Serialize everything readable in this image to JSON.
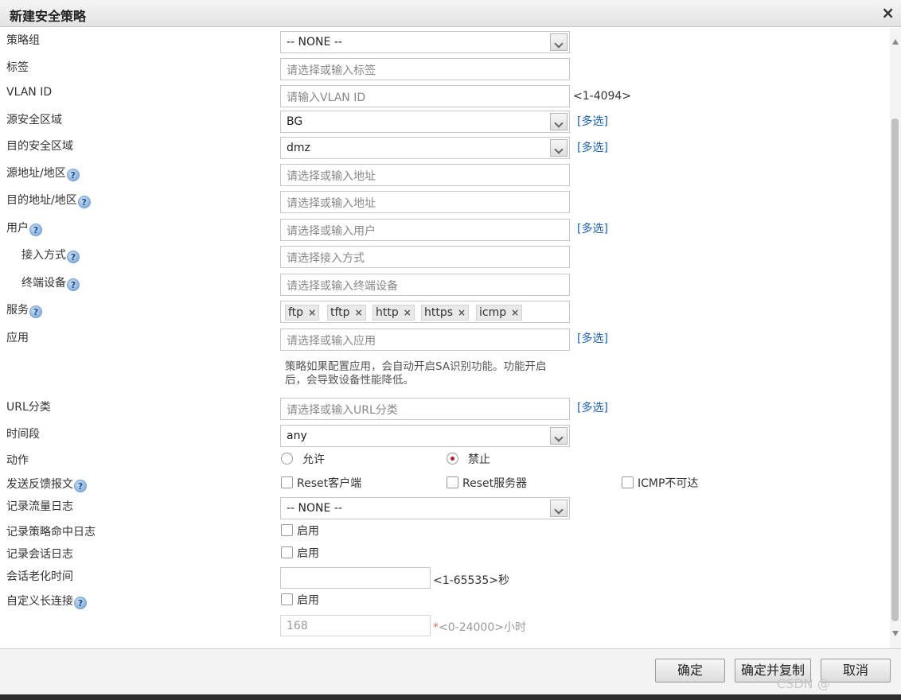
{
  "dialog": {
    "title": "新建安全策略",
    "close": "×"
  },
  "form": {
    "policy_group": {
      "label": "策略组",
      "value": "-- NONE --"
    },
    "tag": {
      "label": "标签",
      "placeholder": "请选择或输入标签"
    },
    "vlan": {
      "label": "VLAN ID",
      "placeholder": "请输入VLAN ID",
      "range": "<1-4094>"
    },
    "src_zone": {
      "label": "源安全区域",
      "value": "BG",
      "multi": "[多选]"
    },
    "dst_zone": {
      "label": "目的安全区域",
      "value": "dmz",
      "multi": "[多选]"
    },
    "src_addr": {
      "label": "源地址/地区",
      "placeholder": "请选择或输入地址"
    },
    "dst_addr": {
      "label": "目的地址/地区",
      "placeholder": "请选择或输入地址"
    },
    "user": {
      "label": "用户",
      "placeholder": "请选择或输入用户",
      "multi": "[多选]"
    },
    "access": {
      "label": "接入方式",
      "placeholder": "请选择接入方式"
    },
    "terminal": {
      "label": "终端设备",
      "placeholder": "请选择或输入终端设备"
    },
    "service": {
      "label": "服务",
      "tags": [
        "ftp",
        "tftp",
        "http",
        "https",
        "icmp"
      ],
      "remove": "×"
    },
    "app": {
      "label": "应用",
      "placeholder": "请选择或输入应用",
      "multi": "[多选]",
      "note_line1": "策略如果配置应用，会自动开启SA识别功能。功能开启",
      "note_line2": "后，会导致设备性能降低。"
    },
    "url": {
      "label": "URL分类",
      "placeholder": "请选择或输入URL分类",
      "multi": "[多选]"
    },
    "time": {
      "label": "时间段",
      "value": "any"
    },
    "action": {
      "label": "动作",
      "allow": "允许",
      "deny": "禁止",
      "selected": "禁止"
    },
    "feedback": {
      "label": "发送反馈报文",
      "opt1": "Reset客户端",
      "opt2": "Reset服务器",
      "opt3": "ICMP不可达"
    },
    "traffic_log": {
      "label": "记录流量日志",
      "value": "-- NONE --"
    },
    "hit_log": {
      "label": "记录策略命中日志",
      "option": "启用"
    },
    "session_log": {
      "label": "记录会话日志",
      "option": "启用"
    },
    "aging": {
      "label": "会话老化时间",
      "value": "",
      "range": "<1-65535>秒"
    },
    "long_conn": {
      "label": "自定义长连接",
      "option": "启用",
      "value": "168",
      "required_mark": "*",
      "range": "<0-24000>小时"
    }
  },
  "footer": {
    "ok": "确定",
    "ok_copy": "确定并复制",
    "cancel": "取消"
  },
  "watermark": "CSDN @"
}
